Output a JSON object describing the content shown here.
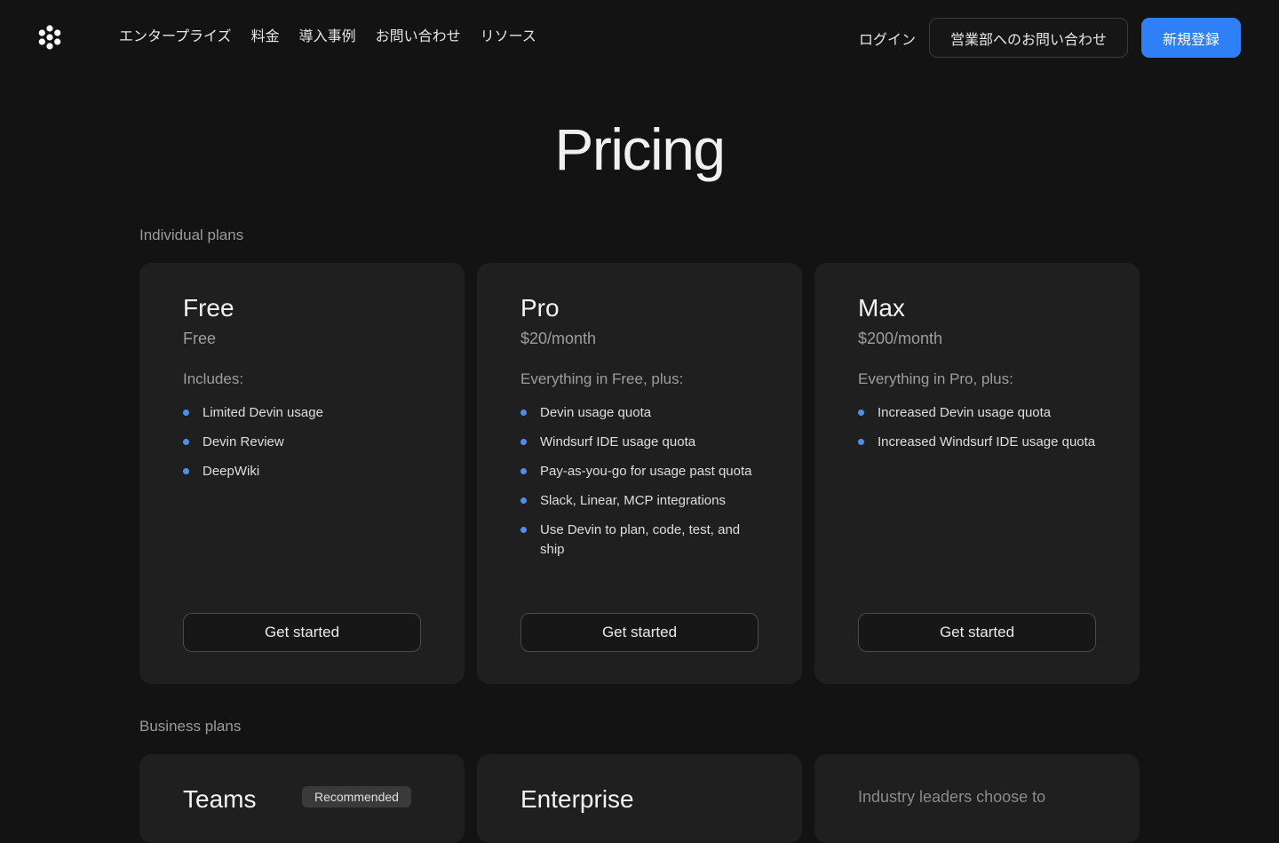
{
  "nav": {
    "links": [
      "エンタープライズ",
      "料金",
      "導入事例",
      "お問い合わせ",
      "リソース"
    ],
    "login": "ログイン",
    "contact_sales": "営業部へのお問い合わせ",
    "signup": "新規登録"
  },
  "page_title": "Pricing",
  "individual": {
    "label": "Individual plans",
    "plans": [
      {
        "name": "Free",
        "price": "Free",
        "intro": "Includes:",
        "features": [
          "Limited Devin usage",
          "Devin Review",
          "DeepWiki"
        ],
        "cta": "Get started"
      },
      {
        "name": "Pro",
        "price": "$20/month",
        "intro": "Everything in Free, plus:",
        "features": [
          "Devin usage quota",
          "Windsurf IDE usage quota",
          "Pay-as-you-go for usage past quota",
          "Slack, Linear, MCP integrations",
          "Use Devin to plan, code, test, and ship"
        ],
        "cta": "Get started"
      },
      {
        "name": "Max",
        "price": "$200/month",
        "intro": "Everything in Pro, plus:",
        "features": [
          "Increased Devin usage quota",
          "Increased Windsurf IDE usage quota"
        ],
        "cta": "Get started"
      }
    ]
  },
  "business": {
    "label": "Business plans",
    "teams_name": "Teams",
    "teams_badge": "Recommended",
    "enterprise_name": "Enterprise",
    "quote": "Industry leaders choose to"
  },
  "colors": {
    "background": "#131313",
    "card": "#1f1f1f",
    "accent": "#2f7ff6",
    "bullet": "#4f8fe8"
  }
}
